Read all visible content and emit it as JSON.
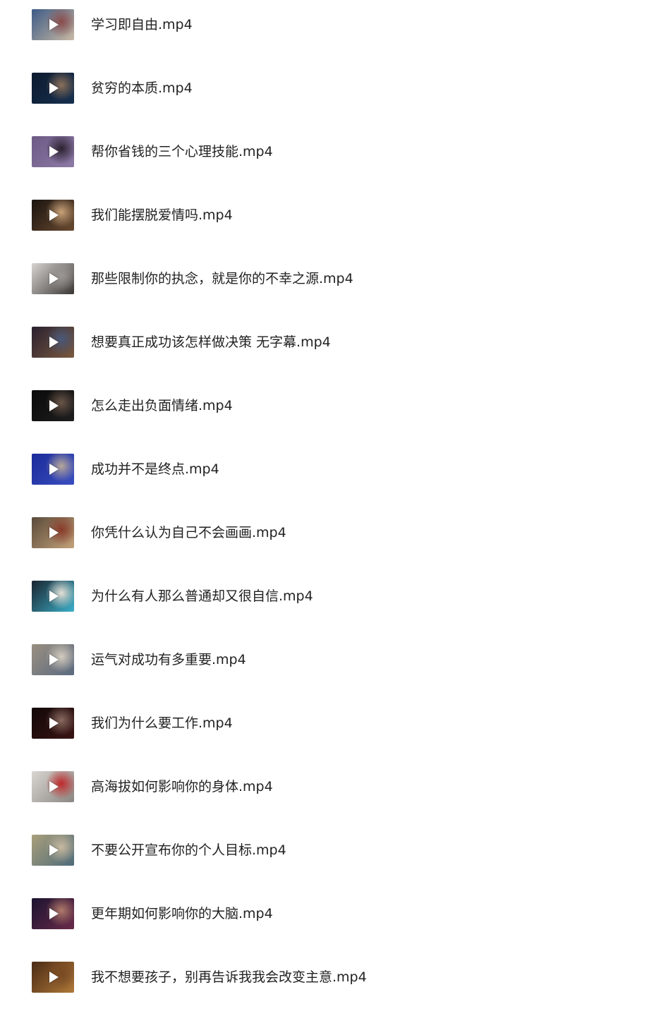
{
  "files": [
    {
      "name": "学习即自由.mp4",
      "thumb_colors": [
        "#3d5b86",
        "#c9b9a4",
        "#8a4b4b"
      ]
    },
    {
      "name": "贫穷的本质.mp4",
      "thumb_colors": [
        "#0c1a2e",
        "#17304f",
        "#8a6f5a"
      ]
    },
    {
      "name": "帮你省钱的三个心理技能.mp4",
      "thumb_colors": [
        "#6d5a85",
        "#8e7aa6",
        "#2b2230"
      ]
    },
    {
      "name": "我们能摆脱爱情吗.mp4",
      "thumb_colors": [
        "#1a1410",
        "#6a4a30",
        "#c9a27a"
      ]
    },
    {
      "name": "那些限制你的执念，就是你的不幸之源.mp4",
      "thumb_colors": [
        "#d8d4d0",
        "#3a3634",
        "#9b9693"
      ]
    },
    {
      "name": "想要真正成功该怎样做决策 无字幕.mp4",
      "thumb_colors": [
        "#2a2030",
        "#7a5a40",
        "#4a5a7a"
      ]
    },
    {
      "name": "怎么走出负面情绪.mp4",
      "thumb_colors": [
        "#0a0a0a",
        "#1e1e1e",
        "#6a5548"
      ]
    },
    {
      "name": "成功并不是终点.mp4",
      "thumb_colors": [
        "#1a2a9a",
        "#3a4fc0",
        "#b7a89a"
      ]
    },
    {
      "name": "你凭什么认为自己不会画画.mp4",
      "thumb_colors": [
        "#5a4a3a",
        "#c4a27a",
        "#8a3a2a"
      ]
    },
    {
      "name": "为什么有人那么普通却又很自信.mp4",
      "thumb_colors": [
        "#1b2430",
        "#3bb0c9",
        "#e4e0d6"
      ]
    },
    {
      "name": "运气对成功有多重要.mp4",
      "thumb_colors": [
        "#9a8f80",
        "#5a6a80",
        "#d3cbbf"
      ]
    },
    {
      "name": "我们为什么要工作.mp4",
      "thumb_colors": [
        "#120808",
        "#3a1414",
        "#8a6a60"
      ]
    },
    {
      "name": "高海拔如何影响你的身体.mp4",
      "thumb_colors": [
        "#d9d6d2",
        "#8a8580",
        "#c0282a"
      ]
    },
    {
      "name": "不要公开宣布你的个人目标.mp4",
      "thumb_colors": [
        "#a99f7a",
        "#4f6b7a",
        "#c7b9a0"
      ]
    },
    {
      "name": "更年期如何影响你的大脑.mp4",
      "thumb_colors": [
        "#1a1430",
        "#6a2a4a",
        "#b07a6a"
      ]
    },
    {
      "name": "我不想要孩子，别再告诉我我会改变主意.mp4",
      "thumb_colors": [
        "#4a2a14",
        "#b07a3a",
        "#7a4a24"
      ]
    }
  ],
  "icons": {
    "play": "play-icon"
  },
  "colors": {
    "text": "#222222",
    "background": "#ffffff",
    "play": "#ffffff"
  }
}
